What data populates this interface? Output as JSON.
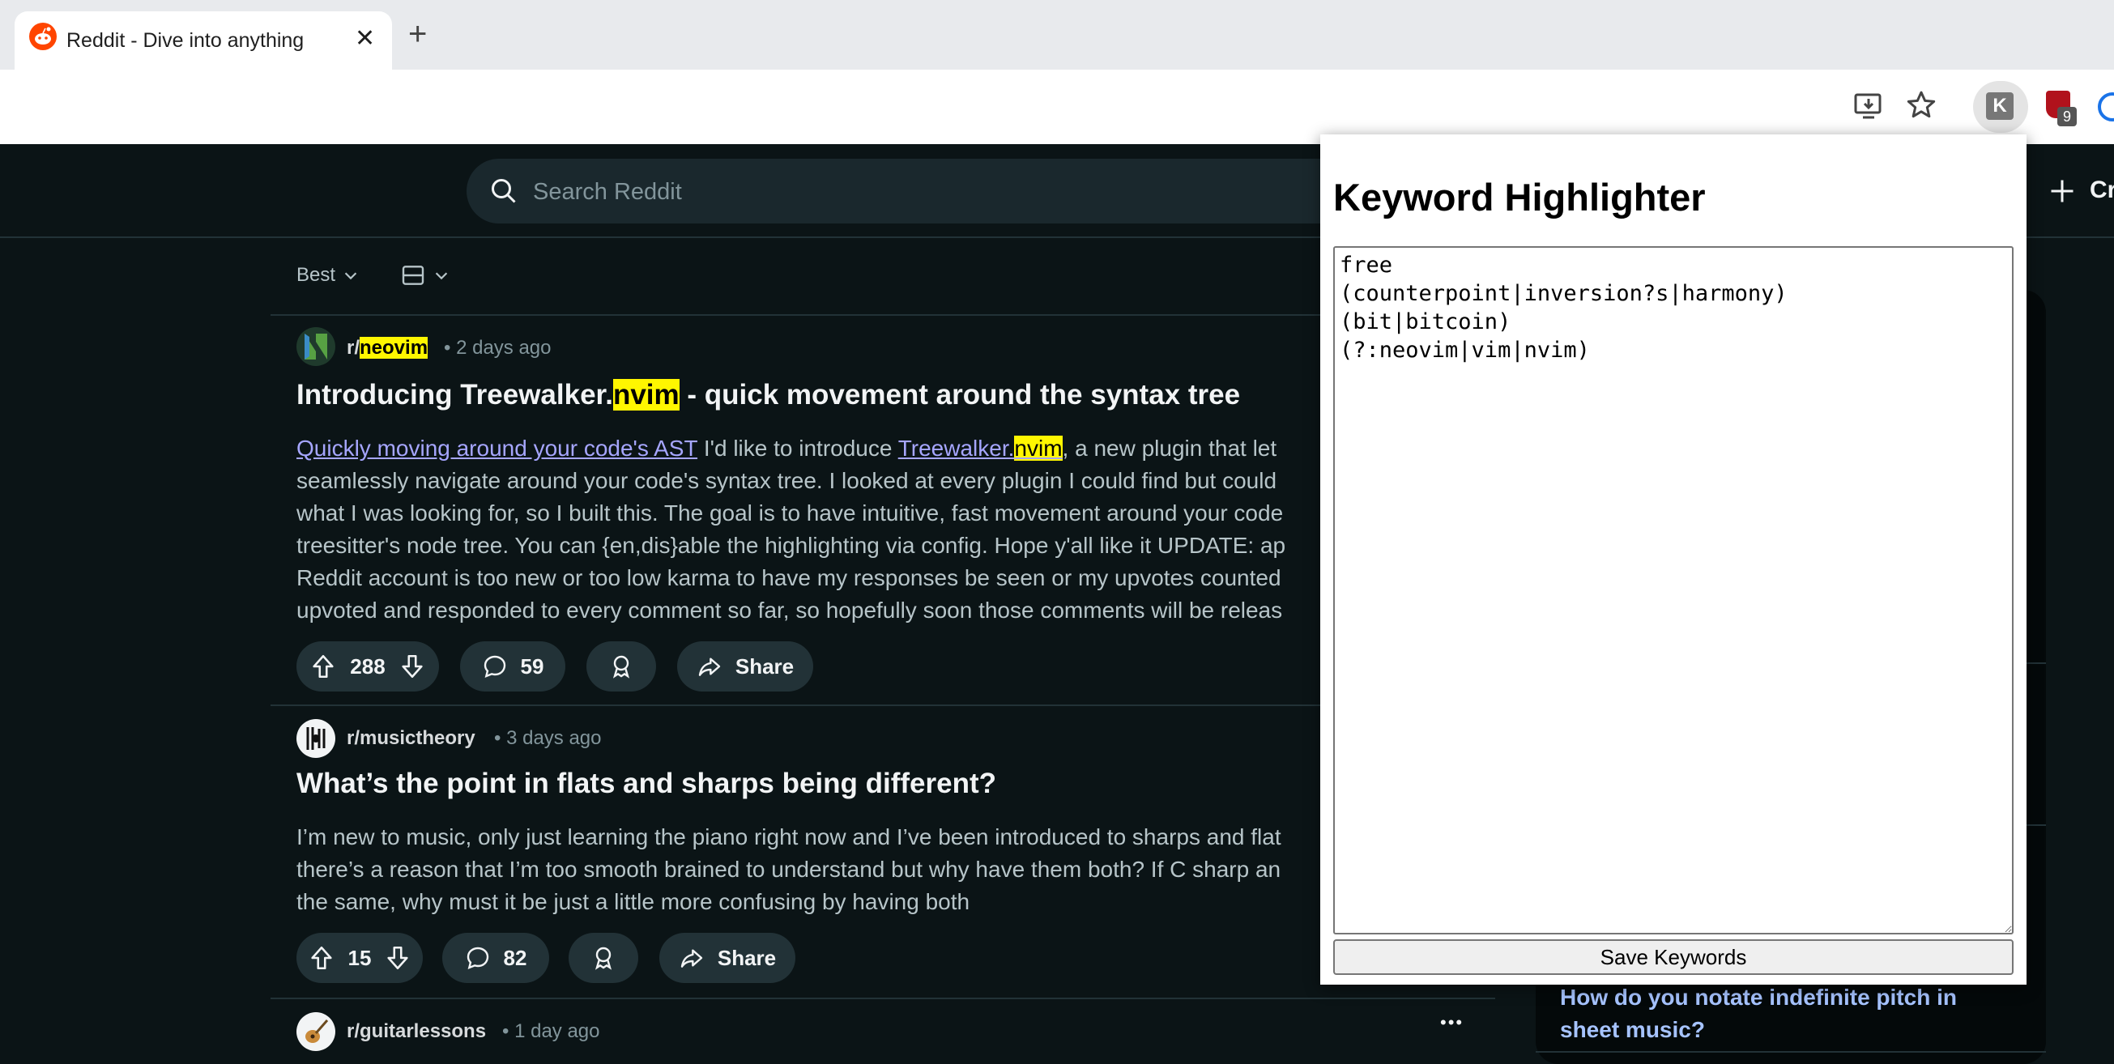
{
  "browser": {
    "tab_title": "Reddit - Dive into anything",
    "tab_close": "✕",
    "new_tab": "+",
    "extension_letter": "K",
    "badge_count": "9"
  },
  "reddit": {
    "search_placeholder": "Search Reddit",
    "create_label": "Cr",
    "sort_label": "Best"
  },
  "posts": [
    {
      "subreddit_prefix": "r/",
      "subreddit_name": "neovim",
      "time": "2 days ago",
      "title_pre": "Introducing Treewalker.",
      "title_hl": "nvim",
      "title_post": " - quick movement around the syntax tree",
      "link1": "Quickly moving around your code's AST",
      "after_link1": " I'd like to introduce ",
      "link2": "Treewalker.",
      "link2_hl": "nvim",
      "after_link2": ", a new plugin that let",
      "lines": [
        "seamlessly navigate around your code's syntax tree. I looked at every plugin I could find but could",
        "what I was looking for, so I built this. The goal is to have intuitive, fast movement around your code",
        "treesitter's node tree. You can {en,dis}able the highlighting via config. Hope y'all like it UPDATE: ap",
        "Reddit account is too new or too low karma to have my responses be seen or my upvotes counted",
        "upvoted and responded to every comment so far, so hopefully soon those comments will be releas"
      ],
      "votes": "288",
      "comments": "59",
      "share": "Share"
    },
    {
      "subreddit": "r/musictheory",
      "time": "3 days ago",
      "title": "What’s the point in flats and sharps being different?",
      "lines": [
        "I’m new to music, only just learning the piano right now and I’ve been introduced to sharps and flat",
        "there’s a reason that I’m too smooth brained to understand but why have them both? If C sharp an",
        "the same, why must it be just a little more confusing by having both"
      ],
      "votes": "15",
      "comments": "82",
      "share": "Share"
    },
    {
      "subreddit": "r/guitarlessons",
      "time": "1 day ago",
      "more": "•••"
    }
  ],
  "sidebar": {
    "post_title_line1": "How do you notate indefinite pitch in",
    "post_title_line2": "sheet music?"
  },
  "popup": {
    "title": "Keyword Highlighter",
    "keywords": "free\n(counterpoint|inversion?s|harmony)\n(bit|bitcoin)\n(?:neovim|vim|nvim)",
    "save_label": "Save Keywords"
  },
  "colors": {
    "highlight": "#fff600",
    "page_bg": "#0b1416",
    "reddit_orange": "#ff4500"
  }
}
